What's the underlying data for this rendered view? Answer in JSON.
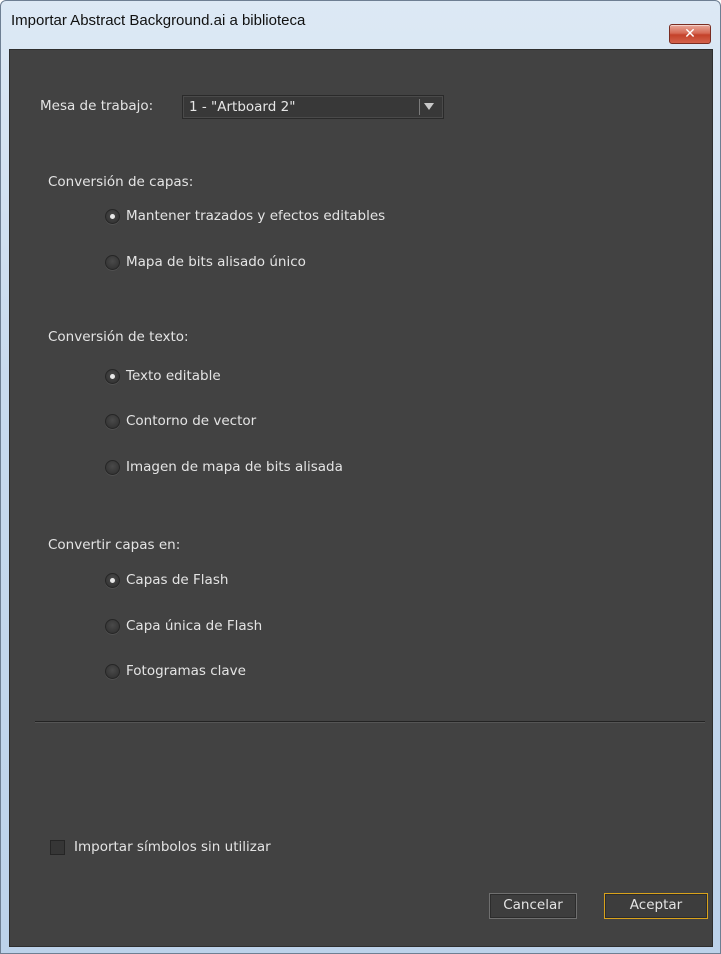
{
  "window": {
    "title": "Importar Abstract Background.ai a biblioteca",
    "close_glyph": "✕"
  },
  "artboard": {
    "label": "Mesa de trabajo:",
    "selected": "1 - \"Artboard 2\""
  },
  "layer_conversion": {
    "heading": "Conversión de capas:",
    "options": [
      {
        "label": "Mantener trazados y efectos editables",
        "checked": true
      },
      {
        "label": "Mapa de bits alisado único",
        "checked": false
      }
    ]
  },
  "text_conversion": {
    "heading": "Conversión de texto:",
    "options": [
      {
        "label": "Texto editable",
        "checked": true
      },
      {
        "label": "Contorno de vector",
        "checked": false
      },
      {
        "label": "Imagen de mapa de bits alisada",
        "checked": false
      }
    ]
  },
  "convert_layers": {
    "heading": "Convertir capas en:",
    "options": [
      {
        "label": "Capas de Flash",
        "checked": true
      },
      {
        "label": "Capa única de Flash",
        "checked": false
      },
      {
        "label": "Fotogramas clave",
        "checked": false
      }
    ]
  },
  "import_unused": {
    "label": "Importar símbolos sin utilizar",
    "checked": false
  },
  "buttons": {
    "cancel": "Cancelar",
    "ok": "Aceptar"
  },
  "colors": {
    "panel": "#424242",
    "ok_border": "#d8a21c",
    "close_button": "#c4412a"
  }
}
